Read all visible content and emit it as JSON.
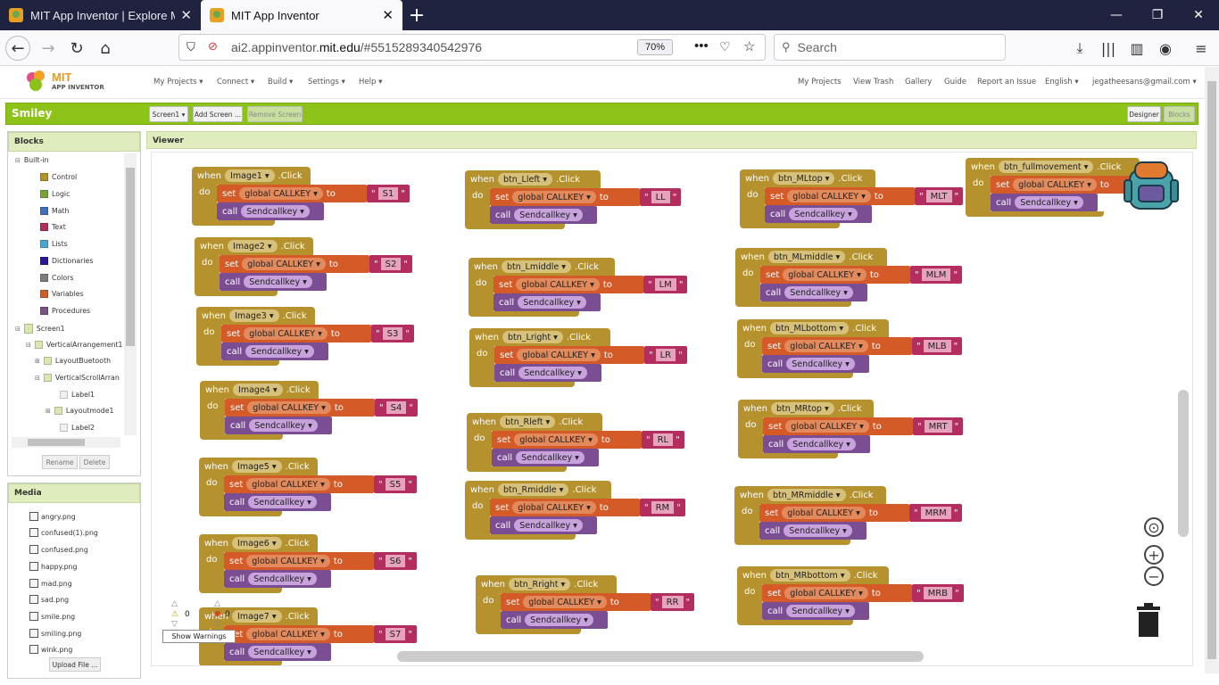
{
  "browser": {
    "tabs": [
      {
        "title": "MIT App Inventor | Explore MIT"
      },
      {
        "title": "MIT App Inventor"
      }
    ],
    "new_tab": "+",
    "window_controls": [
      "—",
      "❐",
      "✕"
    ],
    "url_domain_pre": "ai2.appinventor.",
    "url_domain": "mit.edu",
    "url_path": "/#5515289340542976",
    "zoom": "70%",
    "search_placeholder": "Search"
  },
  "app": {
    "logo_line1": "MIT",
    "logo_line2": "APP INVENTOR",
    "menus": [
      "My Projects ▾",
      "Connect ▾",
      "Build ▾",
      "Settings ▾",
      "Help ▾"
    ],
    "right_menus": [
      "My Projects",
      "View Trash",
      "Gallery",
      "Guide",
      "Report an Issue",
      "English ▾",
      "jegatheesans@gmail.com ▾"
    ],
    "project_name": "Smiley",
    "screen_select": "Screen1 ▾",
    "add_screen": "Add Screen ...",
    "remove_screen": "Remove Screen",
    "designer": "Designer",
    "blocks": "Blocks"
  },
  "blocks_panel": {
    "title": "Blocks",
    "builtin": "Built-in",
    "builtin_items": [
      {
        "label": "Control",
        "color": "#b5922e"
      },
      {
        "label": "Logic",
        "color": "#76a33a"
      },
      {
        "label": "Math",
        "color": "#3f71b5"
      },
      {
        "label": "Text",
        "color": "#b32d5e"
      },
      {
        "label": "Lists",
        "color": "#49a6d4"
      },
      {
        "label": "Dictionaries",
        "color": "#2d1799"
      },
      {
        "label": "Colors",
        "color": "#7d7d7d"
      },
      {
        "label": "Variables",
        "color": "#d05f2d"
      },
      {
        "label": "Procedures",
        "color": "#7c5385"
      }
    ],
    "components": [
      "Screen1",
      "VerticalArrangement1",
      "LayoutBuetooth",
      "VerticalScrollArran",
      "Label1",
      "Layoutmode1",
      "Label2"
    ],
    "rename": "Rename",
    "delete": "Delete"
  },
  "media_panel": {
    "title": "Media",
    "files": [
      "angry.png",
      "confused(1).png",
      "confused.png",
      "happy.png",
      "mad.png",
      "sad.png",
      "smile.png",
      "smiling.png",
      "wink.png"
    ],
    "upload": "Upload File ..."
  },
  "viewer": {
    "title": "Viewer",
    "kw_when": "when",
    "kw_do": "do",
    "kw_set": "set",
    "kw_to": "to",
    "kw_call": "call",
    "kw_click": ".Click",
    "var_name": "global CALLKEY",
    "proc_name": "Sendcallkey",
    "blocks": [
      {
        "component": "Image1",
        "key": "S1"
      },
      {
        "component": "Image2",
        "key": "S2"
      },
      {
        "component": "Image3",
        "key": "S3"
      },
      {
        "component": "Image4",
        "key": "S4"
      },
      {
        "component": "Image5",
        "key": "S5"
      },
      {
        "component": "Image6",
        "key": "S6"
      },
      {
        "component": "Image7",
        "key": "S7"
      },
      {
        "component": "btn_Lleft",
        "key": "LL"
      },
      {
        "component": "btn_Lmiddle",
        "key": "LM"
      },
      {
        "component": "btn_Lright",
        "key": "LR"
      },
      {
        "component": "btn_Rleft",
        "key": "RL"
      },
      {
        "component": "btn_Rmiddle",
        "key": "RM"
      },
      {
        "component": "btn_Rright",
        "key": "RR"
      },
      {
        "component": "btn_MLtop",
        "key": "MLT"
      },
      {
        "component": "btn_MLmiddle",
        "key": "MLM"
      },
      {
        "component": "btn_MLbottom",
        "key": "MLB"
      },
      {
        "component": "btn_MRtop",
        "key": "MRT"
      },
      {
        "component": "btn_MRmiddle",
        "key": "MRM"
      },
      {
        "component": "btn_MRbottom",
        "key": "MRB"
      },
      {
        "component": "btn_fullmovement",
        "key": ""
      }
    ],
    "warnings_count": "0",
    "errors_count": "0",
    "show_warnings": "Show Warnings"
  }
}
